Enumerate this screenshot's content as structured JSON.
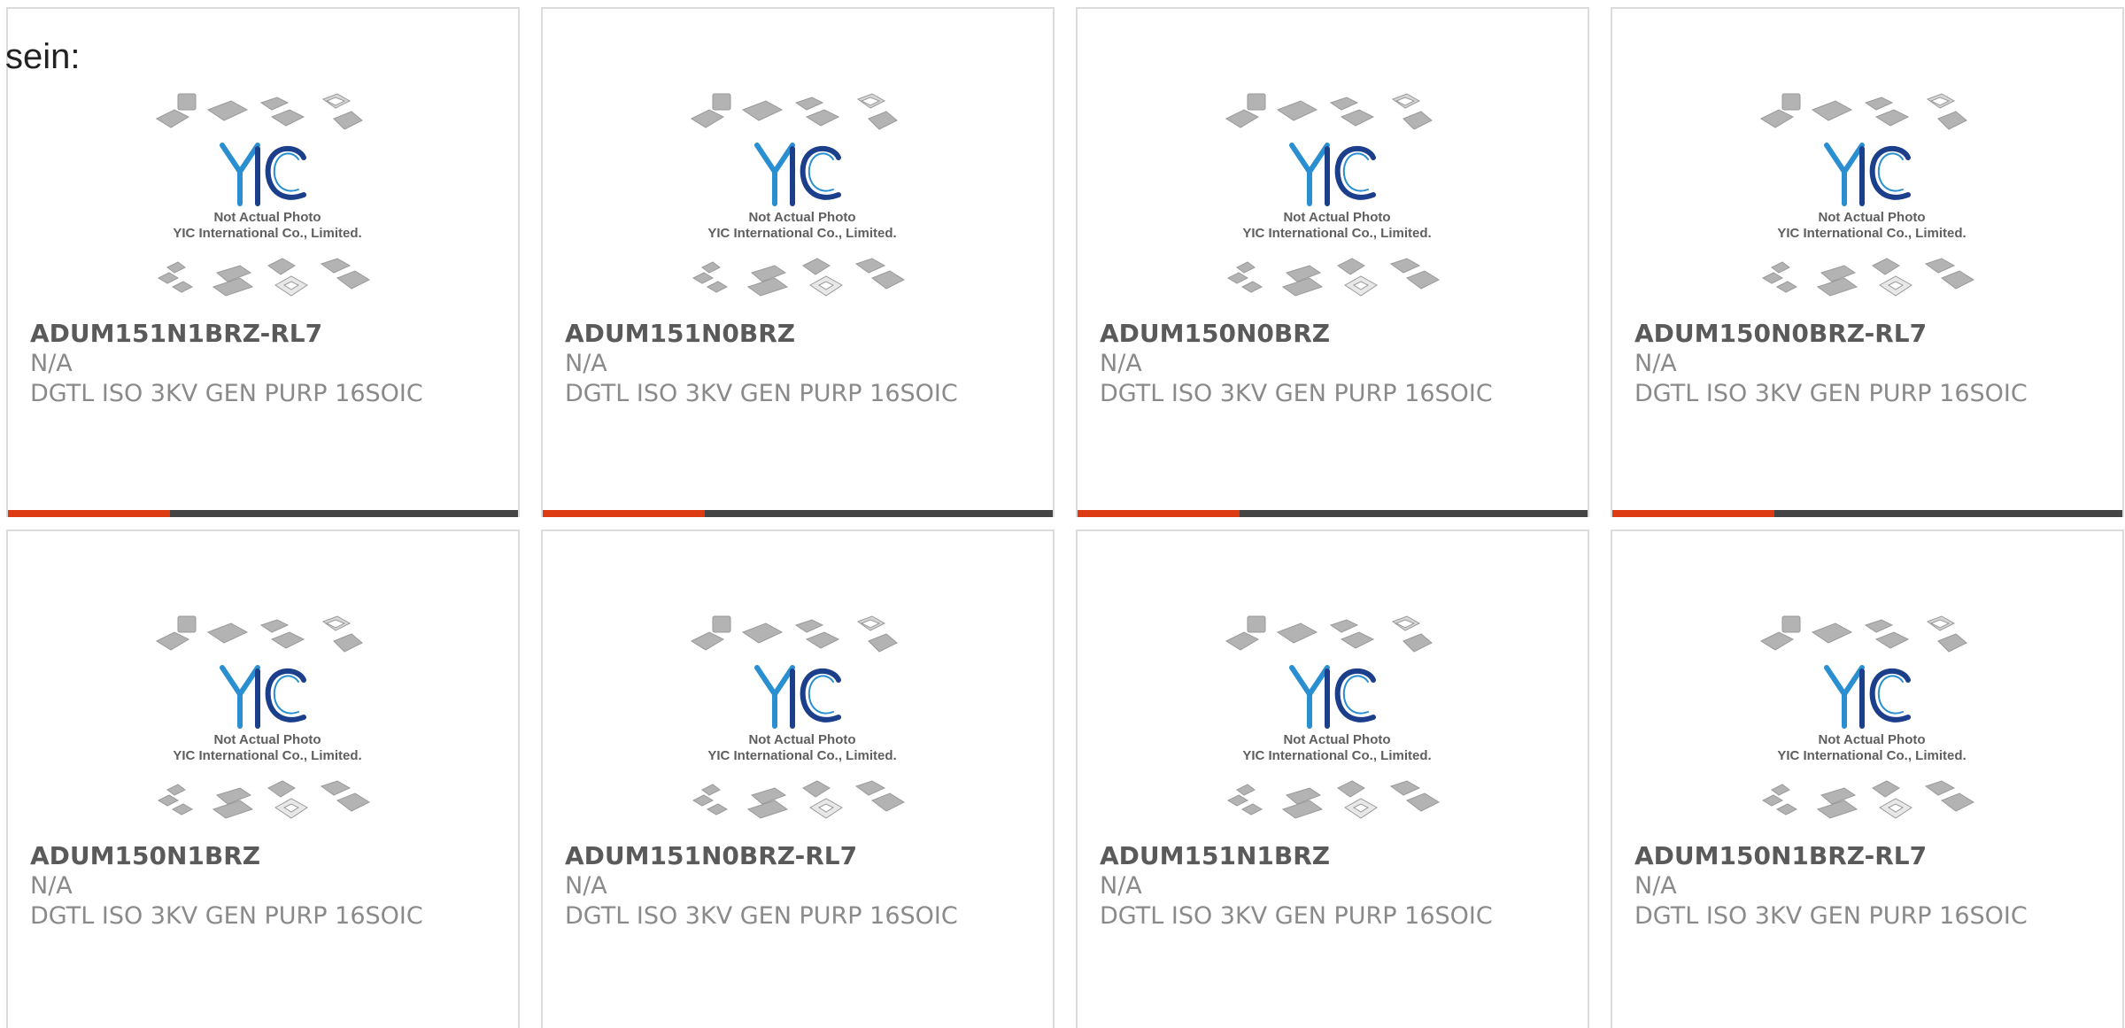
{
  "intro_text": "sein:",
  "placeholder_image": {
    "caption_line1": "Not Actual Photo",
    "caption_line2": "YIC International Co., Limited.",
    "logo_text": "YIC"
  },
  "colors": {
    "accent": "#dd3b13",
    "bar": "#444444",
    "logo_blue": "#2a8fd0",
    "logo_dark": "#1c3f8c"
  },
  "products": [
    {
      "part_number": "ADUM151N1BRZ-RL7",
      "manufacturer": "N/A",
      "description": "DGTL ISO 3KV GEN PURP 16SOIC"
    },
    {
      "part_number": "ADUM151N0BRZ",
      "manufacturer": "N/A",
      "description": "DGTL ISO 3KV GEN PURP 16SOIC"
    },
    {
      "part_number": "ADUM150N0BRZ",
      "manufacturer": "N/A",
      "description": "DGTL ISO 3KV GEN PURP 16SOIC"
    },
    {
      "part_number": "ADUM150N0BRZ-RL7",
      "manufacturer": "N/A",
      "description": "DGTL ISO 3KV GEN PURP 16SOIC"
    },
    {
      "part_number": "ADUM150N1BRZ",
      "manufacturer": "N/A",
      "description": "DGTL ISO 3KV GEN PURP 16SOIC"
    },
    {
      "part_number": "ADUM151N0BRZ-RL7",
      "manufacturer": "N/A",
      "description": "DGTL ISO 3KV GEN PURP 16SOIC"
    },
    {
      "part_number": "ADUM151N1BRZ",
      "manufacturer": "N/A",
      "description": "DGTL ISO 3KV GEN PURP 16SOIC"
    },
    {
      "part_number": "ADUM150N1BRZ-RL7",
      "manufacturer": "N/A",
      "description": "DGTL ISO 3KV GEN PURP 16SOIC"
    }
  ]
}
